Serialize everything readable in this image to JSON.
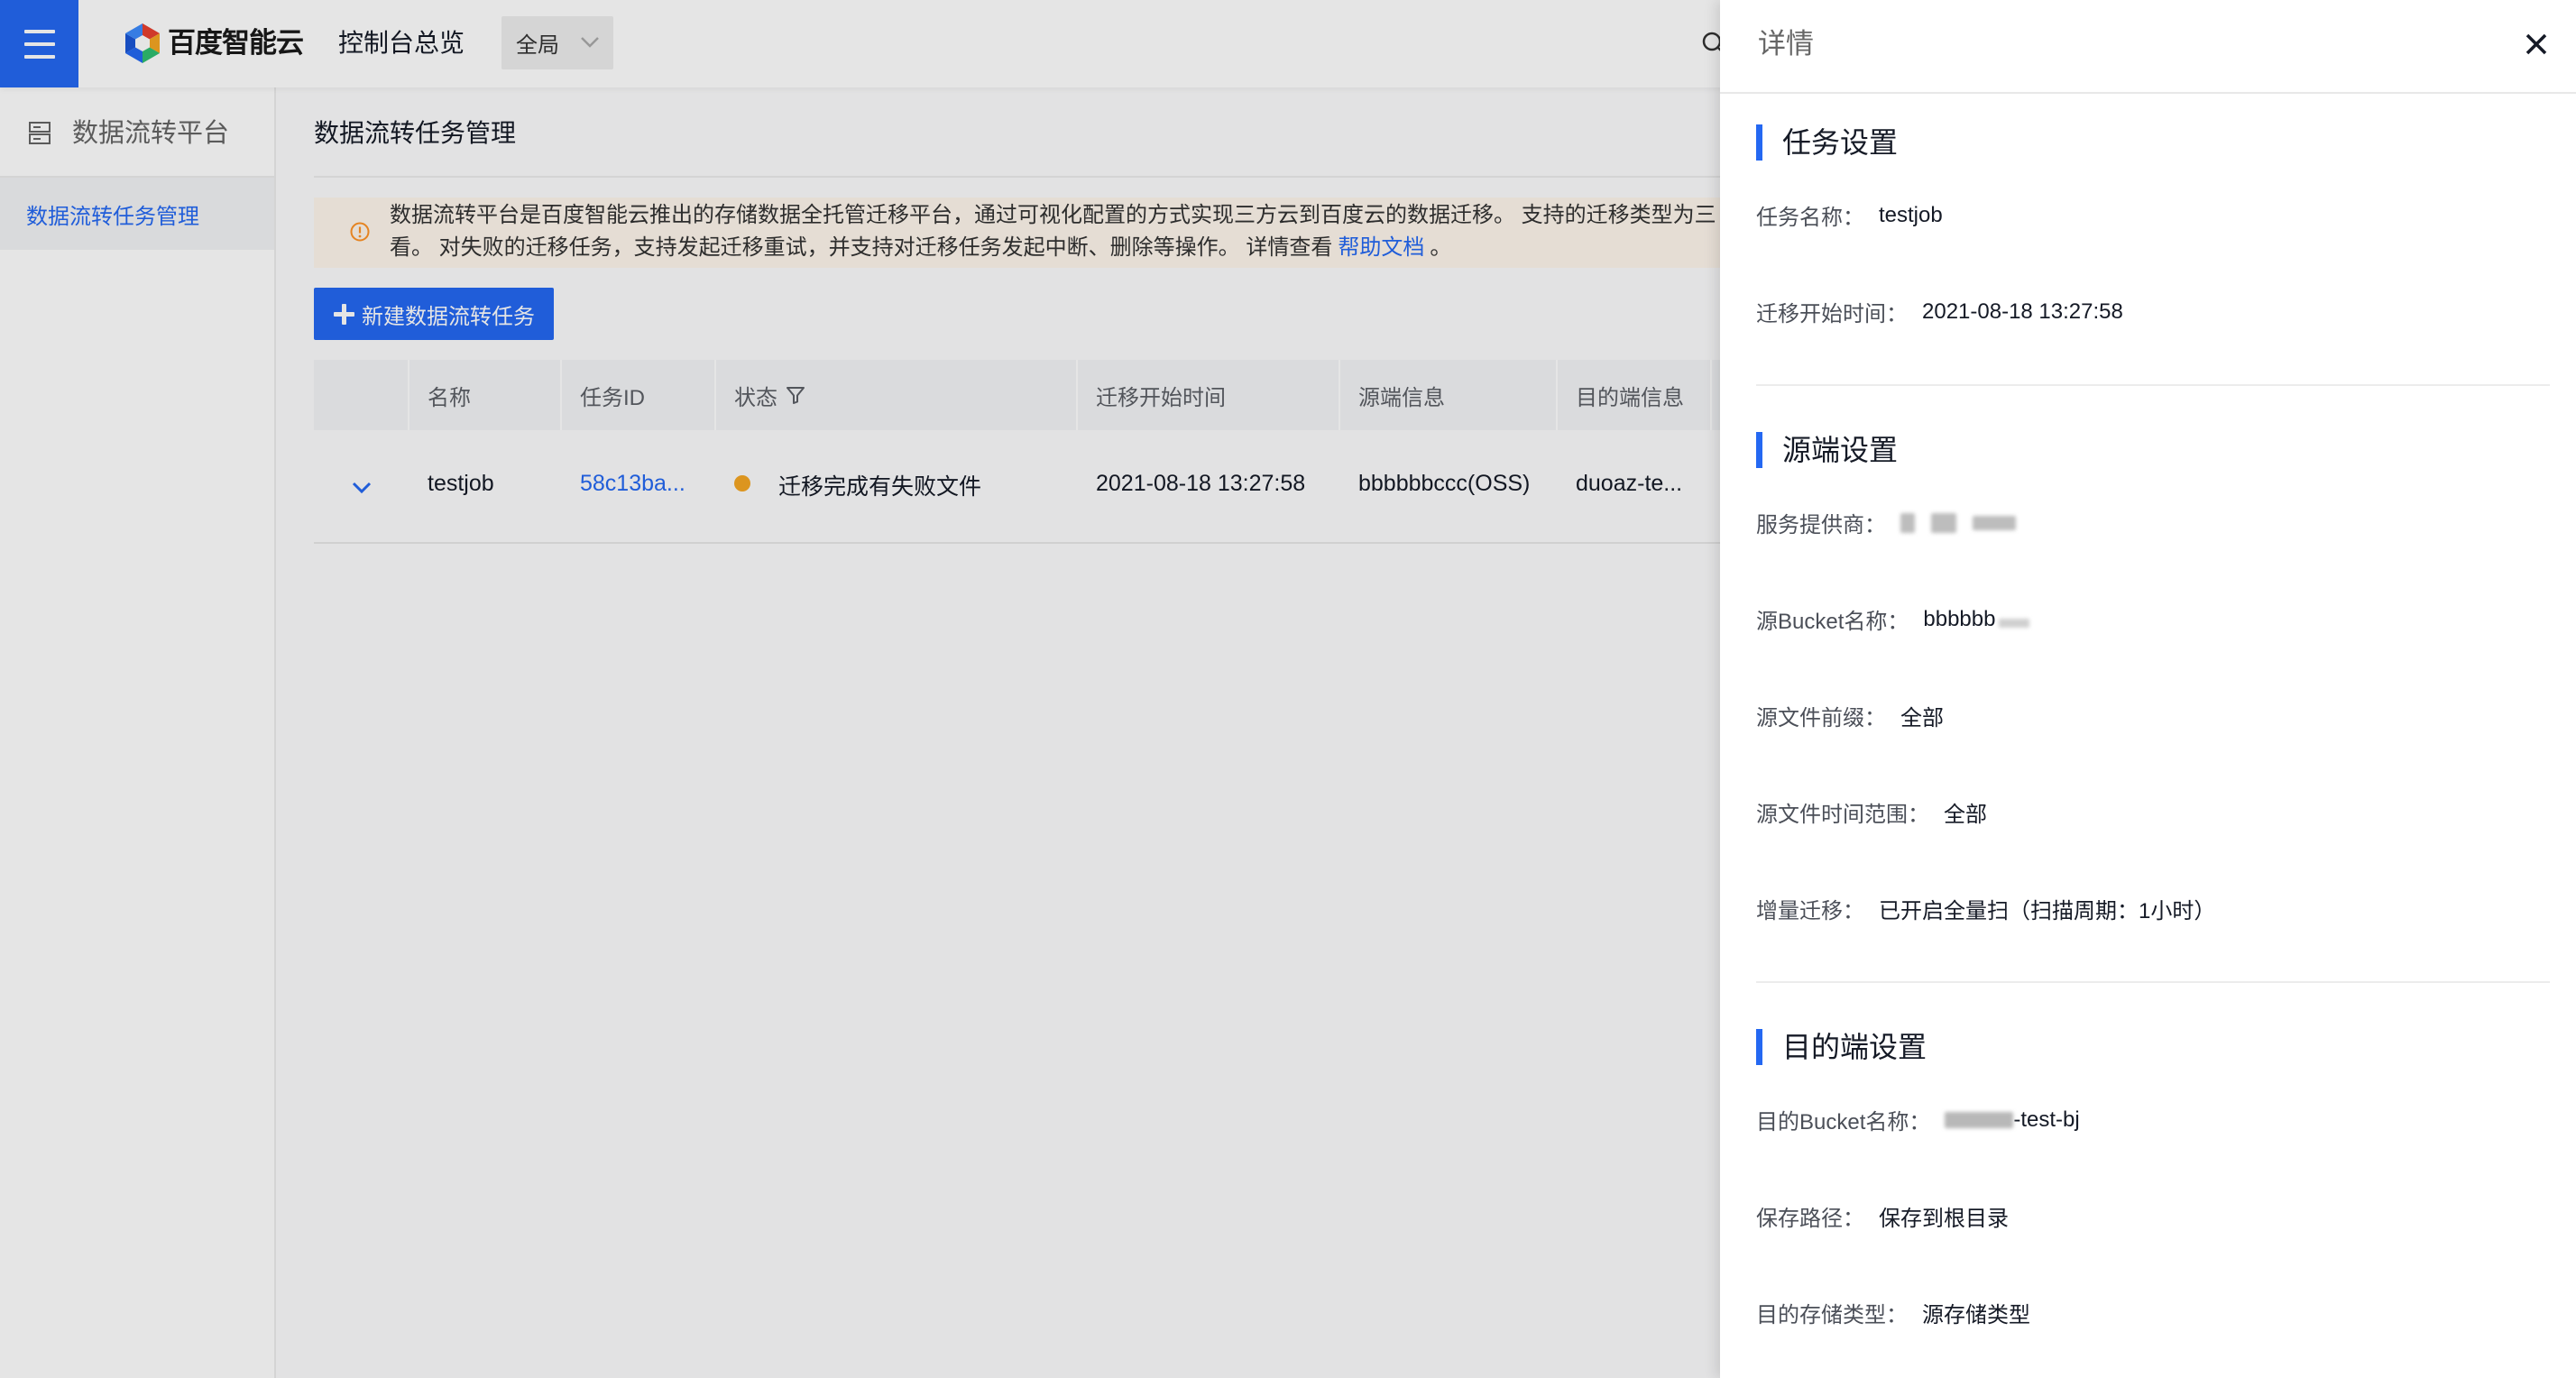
{
  "topbar": {
    "menu_icon": "menu-icon",
    "brand": "百度智能云",
    "console_overview": "控制台总览",
    "region": "全局"
  },
  "sidebar": {
    "header": "数据流转平台",
    "items": [
      {
        "label": "数据流转任务管理",
        "active": true
      }
    ]
  },
  "main": {
    "title": "数据流转任务管理",
    "alert": {
      "line1": "数据流转平台是百度智能云推出的存储数据全托管迁移平台，通过可视化配置的方式实现三方云到百度云的数据迁移。 支持的迁移类型为三",
      "line2": "看。 对失败的迁移任务，支持发起迁移重试，并支持对迁移任务发起中断、删除等操作。 详情查看",
      "help_link": "帮助文档",
      "line2_end": "。"
    },
    "create_button": "新建数据流转任务",
    "table": {
      "columns": [
        "名称",
        "任务ID",
        "状态",
        "迁移开始时间",
        "源端信息",
        "目的端信息"
      ],
      "rows": [
        {
          "name": "testjob",
          "task_id": "58c13ba...",
          "status": "迁移完成有失败文件",
          "start_time": "2021-08-18 13:27:58",
          "source": "bbbbbbccc(OSS)",
          "destination": "duoaz-te..."
        }
      ]
    }
  },
  "drawer": {
    "title": "详情",
    "sections": [
      {
        "title": "任务设置",
        "fields": [
          {
            "label": "任务名称：",
            "value": "testjob"
          },
          {
            "label": "迁移开始时间：",
            "value": "2021-08-18 13:27:58"
          }
        ]
      },
      {
        "title": "源端设置",
        "fields": [
          {
            "label": "服务提供商：",
            "redacted": true
          },
          {
            "label": "源Bucket名称：",
            "value": "bbbbbb",
            "redacted_after": true
          },
          {
            "label": "源文件前缀：",
            "value": "全部"
          },
          {
            "label": "源文件时间范围：",
            "value": "全部"
          },
          {
            "label": "增量迁移：",
            "value": "已开启全量扫（扫描周期：1小时）"
          }
        ]
      },
      {
        "title": "目的端设置",
        "fields": [
          {
            "label": "目的Bucket名称：",
            "value": "-test-bj",
            "redacted_before": true
          },
          {
            "label": "保存路径：",
            "value": "保存到根目录"
          },
          {
            "label": "目的存储类型：",
            "value": "源存储类型"
          }
        ]
      }
    ]
  },
  "colors": {
    "primary": "#2468f2",
    "warning": "#ff9326",
    "status_failed_files": "#f5a623"
  }
}
